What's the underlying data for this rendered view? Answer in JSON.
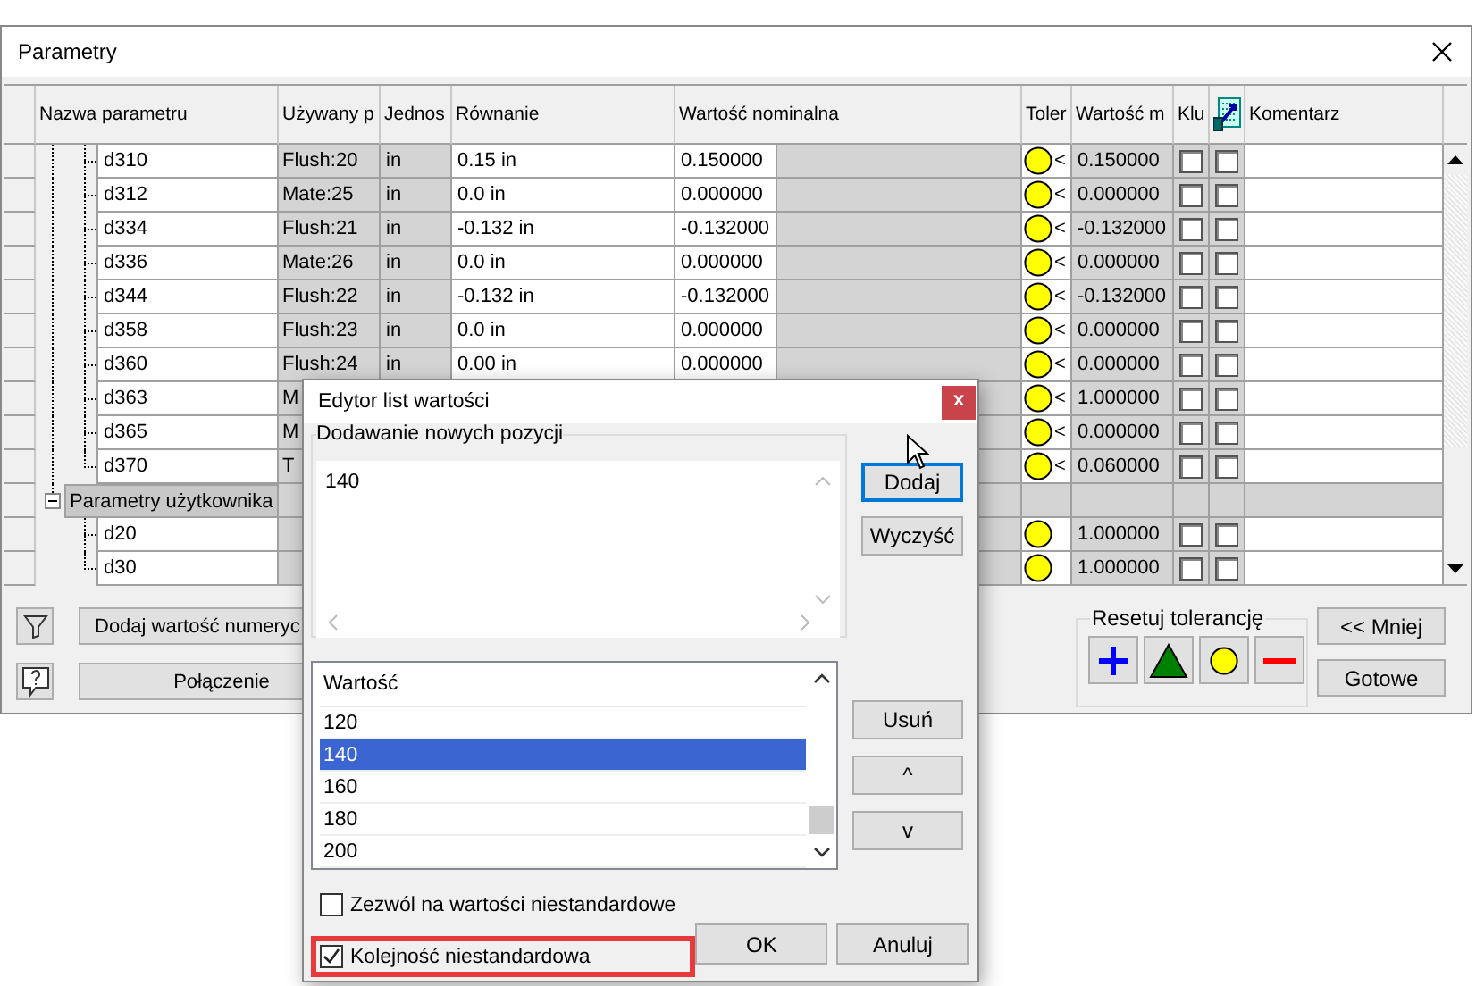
{
  "window": {
    "title": "Parametry"
  },
  "columns": [
    {
      "kind": "text",
      "label": "Nazwa parametru"
    },
    {
      "kind": "text",
      "label": "Używany p"
    },
    {
      "kind": "text",
      "label": "Jednos"
    },
    {
      "kind": "text",
      "label": "Równanie"
    },
    {
      "kind": "text",
      "label": "Wartość nominalna"
    },
    {
      "kind": "text",
      "label": "Toler"
    },
    {
      "kind": "text",
      "label": "Wartość m"
    },
    {
      "kind": "text",
      "label": "Klu"
    },
    {
      "kind": "icon"
    },
    {
      "kind": "text",
      "label": "Komentarz"
    }
  ],
  "rows": [
    {
      "kind": "param",
      "name": "d310",
      "used": "Flush:20",
      "unit": "in",
      "equation": "0.15 in",
      "nominal": "0.150000",
      "tolerance": {
        "kind": "nominal",
        "sign": "<"
      },
      "modeled": "0.150000",
      "key": false,
      "export": false
    },
    {
      "kind": "param",
      "name": "d312",
      "used": "Mate:25",
      "unit": "in",
      "equation": "0.0 in",
      "nominal": "0.000000",
      "tolerance": {
        "kind": "nominal",
        "sign": "<"
      },
      "modeled": "0.000000",
      "key": false,
      "export": false
    },
    {
      "kind": "param",
      "name": "d334",
      "used": "Flush:21",
      "unit": "in",
      "equation": "-0.132 in",
      "nominal": "-0.132000",
      "tolerance": {
        "kind": "nominal",
        "sign": "<"
      },
      "modeled": "-0.132000",
      "key": false,
      "export": false
    },
    {
      "kind": "param",
      "name": "d336",
      "used": "Mate:26",
      "unit": "in",
      "equation": "0.0 in",
      "nominal": "0.000000",
      "tolerance": {
        "kind": "nominal",
        "sign": "<"
      },
      "modeled": "0.000000",
      "key": false,
      "export": false
    },
    {
      "kind": "param",
      "name": "d344",
      "used": "Flush:22",
      "unit": "in",
      "equation": "-0.132 in",
      "nominal": "-0.132000",
      "tolerance": {
        "kind": "nominal",
        "sign": "<"
      },
      "modeled": "-0.132000",
      "key": false,
      "export": false
    },
    {
      "kind": "param",
      "name": "d358",
      "used": "Flush:23",
      "unit": "in",
      "equation": "0.0 in",
      "nominal": "0.000000",
      "tolerance": {
        "kind": "nominal",
        "sign": "<"
      },
      "modeled": "0.000000",
      "key": false,
      "export": false
    },
    {
      "kind": "param",
      "name": "d360",
      "used": "Flush:24",
      "unit": "in",
      "equation": "0.00 in",
      "nominal": "0.000000",
      "tolerance": {
        "kind": "nominal",
        "sign": "<"
      },
      "modeled": "0.000000",
      "key": false,
      "export": false
    },
    {
      "kind": "param",
      "name": "d363",
      "used": "M",
      "tolerance": {
        "kind": "nominal",
        "sign": "<"
      },
      "modeled": "1.000000",
      "key": false,
      "export": false
    },
    {
      "kind": "param",
      "name": "d365",
      "used": "M",
      "tolerance": {
        "kind": "nominal",
        "sign": "<"
      },
      "modeled": "0.000000",
      "key": false,
      "export": false
    },
    {
      "kind": "param",
      "name": "d370",
      "used": "T",
      "tolerance": {
        "kind": "nominal",
        "sign": "<"
      },
      "modeled": "0.060000",
      "key": false,
      "export": false
    },
    {
      "kind": "group",
      "label": "Parametry użytkownika",
      "expanded": true,
      "children": [
        {
          "kind": "param",
          "name": "d20",
          "tolerance": {
            "kind": "nominal"
          },
          "modeled": "1.000000",
          "key": false,
          "export": false
        },
        {
          "kind": "param",
          "name": "d30",
          "tolerance": {
            "kind": "nominal"
          },
          "modeled": "1.000000",
          "key": false,
          "export": false
        }
      ]
    }
  ],
  "bottom": {
    "add_button": "Dodaj wartość numeryc",
    "link_button": "Połączenie",
    "reset_label": "Resetuj tolerancję",
    "reset_buttons": [
      {
        "kind": "upper"
      },
      {
        "kind": "mean"
      },
      {
        "kind": "nominal"
      },
      {
        "kind": "lower"
      }
    ],
    "less_button": "<< Mniej",
    "done_button": "Gotowe"
  },
  "dialog": {
    "title": "Edytor list wartości",
    "close": "x",
    "add_group": "Dodawanie nowych pozycji",
    "new_value": "140",
    "add_button": "Dodaj",
    "clear_button": "Wyczyść",
    "list_header": "Wartość",
    "items": [
      {
        "label": "120",
        "selected": false
      },
      {
        "label": "140",
        "selected": true
      },
      {
        "label": "160",
        "selected": false
      },
      {
        "label": "180",
        "selected": false
      },
      {
        "label": "200",
        "selected": false
      }
    ],
    "remove_button": "Usuń",
    "up_button": "^",
    "down_button": "v",
    "options": [
      {
        "label": "Zezwól na wartości niestandardowe",
        "checked": false,
        "highlighted": false
      },
      {
        "label": "Kolejność niestandardowa",
        "checked": true,
        "highlighted": true
      }
    ],
    "ok_button": "OK",
    "cancel_button": "Anuluj"
  }
}
